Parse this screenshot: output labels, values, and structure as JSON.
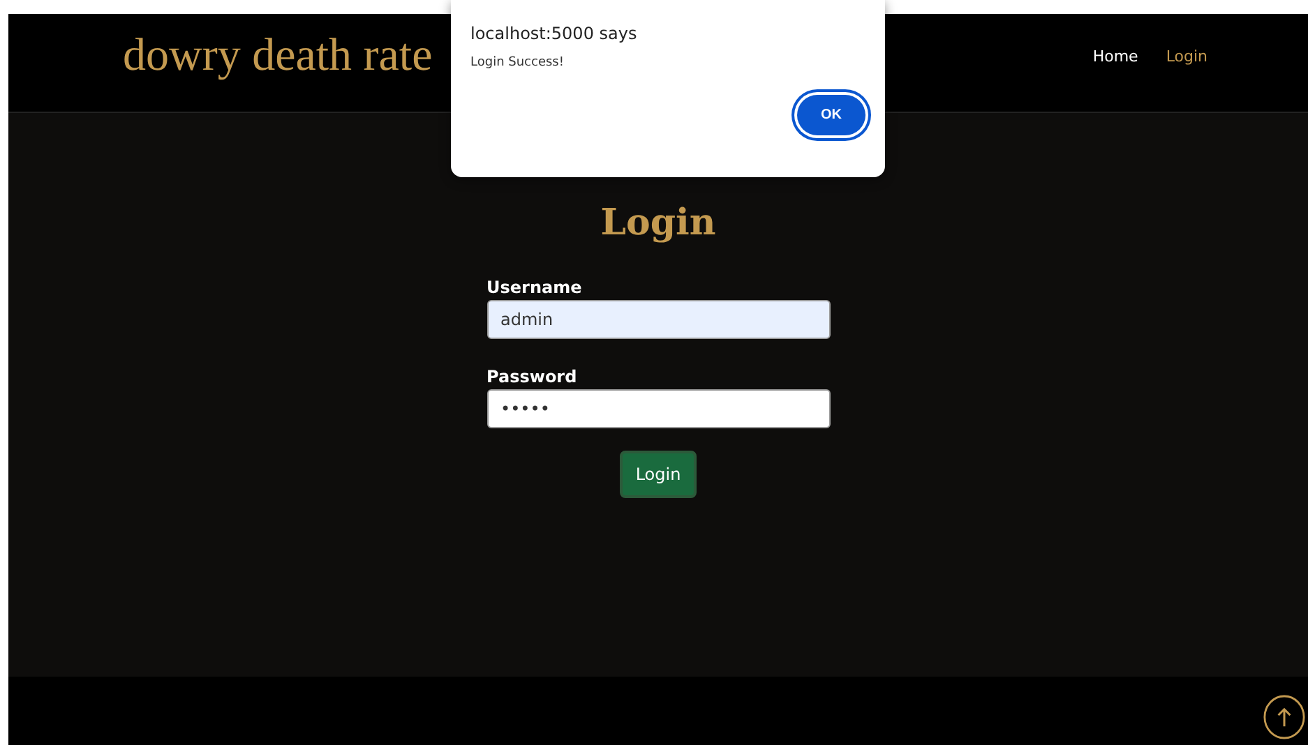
{
  "header": {
    "brand": "dowry death rate",
    "nav": [
      {
        "label": "Home",
        "selected": false
      },
      {
        "label": "Login",
        "selected": true
      }
    ]
  },
  "form": {
    "title": "Login",
    "fields": [
      {
        "label": "Username",
        "value": "admin",
        "autofilled": true
      },
      {
        "label": "Password",
        "value": "•••••",
        "autofilled": false
      }
    ],
    "submit": "Login"
  },
  "dialog": {
    "title": "localhost:5000 says",
    "message": "Login Success!",
    "button": "OK"
  }
}
